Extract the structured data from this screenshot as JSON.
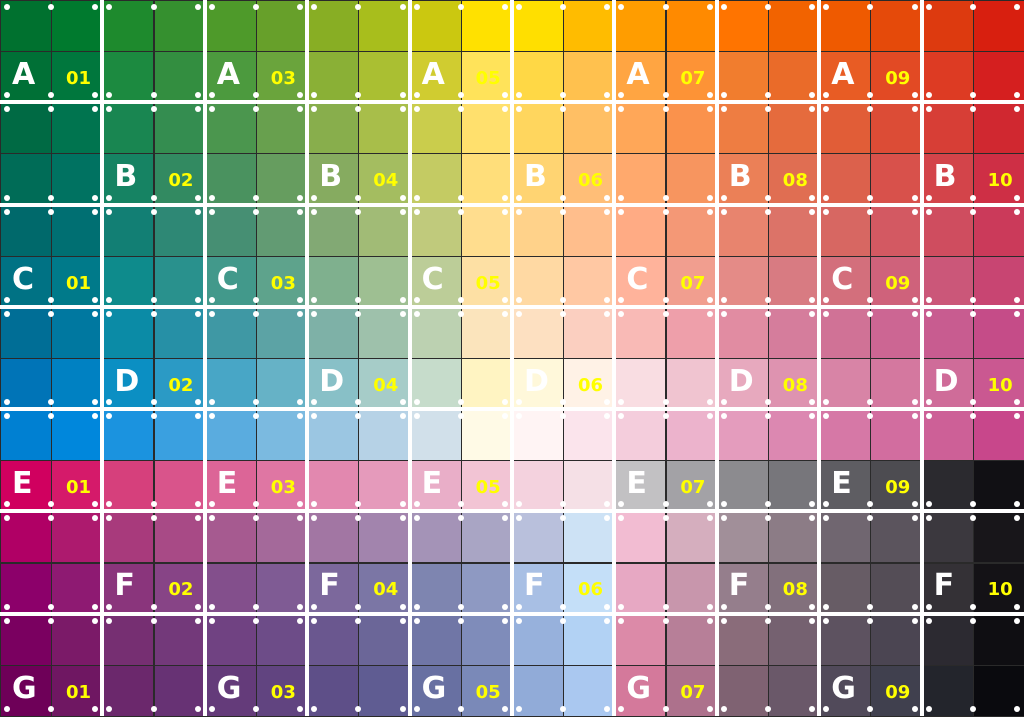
{
  "rows": [
    "A",
    "B",
    "C",
    "D",
    "E",
    "F",
    "G"
  ],
  "columns": [
    "01",
    "02",
    "03",
    "04",
    "05",
    "06",
    "07",
    "08",
    "09",
    "10"
  ],
  "swatch_colors": [
    [
      "#00712f",
      "#007a2e",
      "#1e8a2d",
      "#35902f",
      "#4e9a2a",
      "#67a02a",
      "#88ae24",
      "#a8be1c",
      "#cbc810",
      "#ffe100",
      "#ffdf00",
      "#ffbc00",
      "#ff9d00",
      "#ff8a00",
      "#ff7400",
      "#f26300",
      "#ef5a00",
      "#e54a0a",
      "#dd3a0f",
      "#d81f0f"
    ],
    [
      "#007036",
      "#00773d",
      "#1c8a40",
      "#338e40",
      "#4c9a3e",
      "#6aa43c",
      "#8ab036",
      "#aabf32",
      "#d0cc30",
      "#ffe35a",
      "#ffd845",
      "#ffc14e",
      "#ffa542",
      "#fd9336",
      "#f17d2e",
      "#ea6b29",
      "#e85c24",
      "#e24a24",
      "#dd3b23",
      "#d51f1f"
    ],
    [
      "#006a44",
      "#00744f",
      "#198651",
      "#348d50",
      "#4b964e",
      "#68a04e",
      "#88ae4c",
      "#a8be4a",
      "#cacd4c",
      "#ffe06d",
      "#ffd65e",
      "#ffbf64",
      "#ffa758",
      "#fa924c",
      "#ee7d42",
      "#e56b3d",
      "#e15d37",
      "#dc4c36",
      "#d73e36",
      "#d02830"
    ],
    [
      "#006c57",
      "#007261",
      "#168363",
      "#328a61",
      "#4a925f",
      "#669d5f",
      "#86ab60",
      "#a4bd60",
      "#c4cb63",
      "#ffde7a",
      "#ffd472",
      "#ffbe77",
      "#ffa96d",
      "#f7955f",
      "#eb8057",
      "#e06e52",
      "#dc614c",
      "#d8514b",
      "#d3444a",
      "#ce2f45"
    ],
    [
      "#00696b",
      "#006f72",
      "#127f74",
      "#2e8875",
      "#468f73",
      "#629b73",
      "#82a974",
      "#a1bb76",
      "#c0ca7c",
      "#ffdd8e",
      "#ffd28a",
      "#ffbe8c",
      "#ffab84",
      "#f49876",
      "#e8846e",
      "#dc7368",
      "#d76762",
      "#d35962",
      "#cf4d5f",
      "#cb3a5a"
    ],
    [
      "#007284",
      "#007a8a",
      "#0e8b8c",
      "#29918d",
      "#42998b",
      "#5ea38c",
      "#7fb08e",
      "#9ebf92",
      "#bccd98",
      "#fde0a4",
      "#ffd9a3",
      "#ffc8a3",
      "#ffb39b",
      "#f19e8f",
      "#e48b87",
      "#d87b82",
      "#d36f7c",
      "#cf627b",
      "#cb5779",
      "#c84572"
    ],
    [
      "#006e96",
      "#0078a0",
      "#0b8ba6",
      "#2690a6",
      "#3f98a4",
      "#5ca3a5",
      "#7eb1a7",
      "#9ec1ab",
      "#bcd1b1",
      "#fbe4bc",
      "#fde0c1",
      "#fbcfc0",
      "#f9bab6",
      "#ee9faa",
      "#e18ca2",
      "#d57d9c",
      "#d07296",
      "#cc6693",
      "#c85c90",
      "#c54c88"
    ],
    [
      "#0074b7",
      "#0081c2",
      "#0b8fc3",
      "#2b9ac5",
      "#48a6c6",
      "#66b2c6",
      "#88c0c7",
      "#a6ccc8",
      "#c6dccb",
      "#fff4c2",
      "#fff8da",
      "#fff2e6",
      "#f9dde2",
      "#f0c4d0",
      "#e7a9be",
      "#de93b0",
      "#d884a6",
      "#d4789f",
      "#cf6c99",
      "#ca5891"
    ],
    [
      "#0080d2",
      "#0087dc",
      "#1b93df",
      "#3aa0e0",
      "#5aacdf",
      "#7bbae0",
      "#9bc6e2",
      "#b6d2e6",
      "#d1e0ea",
      "#fffae6",
      "#fff4f4",
      "#fbe4ec",
      "#f4cddc",
      "#ecb3cc",
      "#e49cbd",
      "#dc88b1",
      "#d678a6",
      "#d26d9f",
      "#cd6097",
      "#c8478b"
    ],
    [
      "#d0005f",
      "#d51a6a",
      "#d6407c",
      "#d9548b",
      "#dc6597",
      "#df76a3",
      "#e288af",
      "#e59abb",
      "#e9aec8",
      "#f2c4d4",
      "#f4d2de",
      "#f5e0e6",
      "#c2c1c3",
      "#a3a2a6",
      "#8c8b8f",
      "#77767b",
      "#5e5d62",
      "#4d4c51",
      "#2b2a2f",
      "#111014"
    ],
    [
      "#b00065",
      "#ad1a6e",
      "#a83a7c",
      "#a84a86",
      "#a65a90",
      "#a4699a",
      "#a276a3",
      "#a284ad",
      "#a493b7",
      "#a9a5c4",
      "#b9c0dc",
      "#cde2f5",
      "#f2bcd2",
      "#d5aebe",
      "#a18f99",
      "#8c7c86",
      "#706670",
      "#5b545d",
      "#3b383e",
      "#18161a"
    ],
    [
      "#8c006a",
      "#8e1a72",
      "#8a357c",
      "#874486",
      "#834f8c",
      "#7f5b94",
      "#7c689c",
      "#7b76a5",
      "#7e85b0",
      "#8e99c2",
      "#a8bfe4",
      "#c4dff8",
      "#e7a8c3",
      "#c896ac",
      "#957e8c",
      "#82707c",
      "#675c65",
      "#544d56",
      "#343136",
      "#141216"
    ],
    [
      "#7a0060",
      "#7b1a68",
      "#762f72",
      "#73397a",
      "#704282",
      "#6d4c88",
      "#6a578f",
      "#6b6698",
      "#7076a6",
      "#7f8cba",
      "#97b1dc",
      "#b2d2f4",
      "#dc8aa8",
      "#b77f98",
      "#8a6c7a",
      "#756170",
      "#5d5260",
      "#4b4552",
      "#2c2a31",
      "#0f0e12"
    ],
    [
      "#6e0058",
      "#6f1762",
      "#6b286c",
      "#673274",
      "#643b7a",
      "#614480",
      "#5e4f88",
      "#5f5c92",
      "#6870a2",
      "#7a89b8",
      "#91abd8",
      "#aac8f0",
      "#d4799b",
      "#ad718c",
      "#7f6272",
      "#6a5869",
      "#514a5a",
      "#40404e",
      "#23252c",
      "#0a0a0e"
    ]
  ],
  "labels": [
    {
      "row": "A",
      "col": "01"
    },
    {
      "row": "A",
      "col": "03"
    },
    {
      "row": "A",
      "col": "05"
    },
    {
      "row": "A",
      "col": "07"
    },
    {
      "row": "A",
      "col": "09"
    },
    {
      "row": "B",
      "col": "02"
    },
    {
      "row": "B",
      "col": "04"
    },
    {
      "row": "B",
      "col": "06"
    },
    {
      "row": "B",
      "col": "08"
    },
    {
      "row": "B",
      "col": "10"
    },
    {
      "row": "C",
      "col": "01"
    },
    {
      "row": "C",
      "col": "03"
    },
    {
      "row": "C",
      "col": "05"
    },
    {
      "row": "C",
      "col": "07"
    },
    {
      "row": "C",
      "col": "09"
    },
    {
      "row": "D",
      "col": "02"
    },
    {
      "row": "D",
      "col": "04"
    },
    {
      "row": "D",
      "col": "06"
    },
    {
      "row": "D",
      "col": "08"
    },
    {
      "row": "D",
      "col": "10"
    },
    {
      "row": "E",
      "col": "01"
    },
    {
      "row": "E",
      "col": "03"
    },
    {
      "row": "E",
      "col": "05"
    },
    {
      "row": "E",
      "col": "07"
    },
    {
      "row": "E",
      "col": "09"
    },
    {
      "row": "F",
      "col": "02"
    },
    {
      "row": "F",
      "col": "04"
    },
    {
      "row": "F",
      "col": "06"
    },
    {
      "row": "F",
      "col": "08"
    },
    {
      "row": "F",
      "col": "10"
    },
    {
      "row": "G",
      "col": "01"
    },
    {
      "row": "G",
      "col": "03"
    },
    {
      "row": "G",
      "col": "05"
    },
    {
      "row": "G",
      "col": "07"
    },
    {
      "row": "G",
      "col": "09"
    }
  ],
  "label_colors": {
    "row": "#ffffff",
    "column": "#ffff00"
  }
}
